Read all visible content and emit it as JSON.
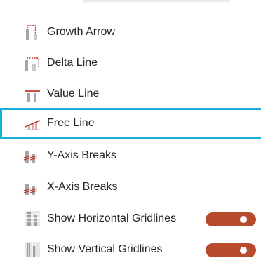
{
  "menu": {
    "items": [
      {
        "label": "Growth Arrow",
        "icon": "growth-arrow-icon"
      },
      {
        "label": "Delta Line",
        "icon": "delta-line-icon"
      },
      {
        "label": "Value Line",
        "icon": "value-line-icon"
      },
      {
        "label": "Free Line",
        "icon": "free-line-icon",
        "selected": true
      },
      {
        "label": "Y-Axis Breaks",
        "icon": "y-axis-breaks-icon"
      },
      {
        "label": "X-Axis Breaks",
        "icon": "x-axis-breaks-icon"
      },
      {
        "label": "Show Horizontal Gridlines",
        "icon": "horizontal-gridlines-icon",
        "toggle_on": true
      },
      {
        "label": "Show Vertical Gridlines",
        "icon": "vertical-gridlines-icon",
        "toggle_on": true
      }
    ]
  },
  "colors": {
    "accent_selection": "#17b0d8",
    "toggle_on": "#b84a2d",
    "icon_red": "#c0392b",
    "icon_gray": "#9e9e9e"
  }
}
